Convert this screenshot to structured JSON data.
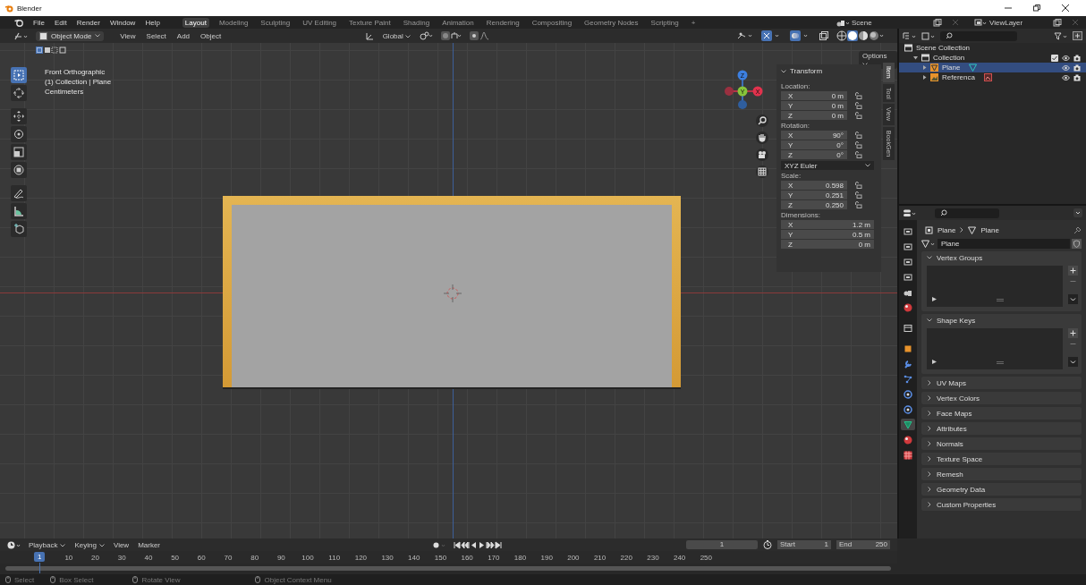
{
  "window": {
    "title": "Blender"
  },
  "menu": [
    "File",
    "Edit",
    "Render",
    "Window",
    "Help"
  ],
  "workspaces": [
    {
      "label": "Layout",
      "selected": true
    },
    {
      "label": "Modeling",
      "selected": false
    },
    {
      "label": "Sculpting",
      "selected": false
    },
    {
      "label": "UV Editing",
      "selected": false
    },
    {
      "label": "Texture Paint",
      "selected": false
    },
    {
      "label": "Shading",
      "selected": false
    },
    {
      "label": "Animation",
      "selected": false
    },
    {
      "label": "Rendering",
      "selected": false
    },
    {
      "label": "Compositing",
      "selected": false
    },
    {
      "label": "Geometry Nodes",
      "selected": false
    },
    {
      "label": "Scripting",
      "selected": false
    }
  ],
  "add_workspace": "+",
  "scene": "Scene",
  "view_layer": "ViewLayer",
  "viewport_header": {
    "mode": "Object Mode",
    "menus": [
      "View",
      "Select",
      "Add",
      "Object"
    ],
    "orientation": "Global",
    "options": "Options"
  },
  "overlay_text": [
    "Front Orthographic",
    "(1) Collection | Plane",
    "Centimeters"
  ],
  "tools": [
    {
      "kind": "select",
      "selected": true
    },
    {
      "kind": "cursor",
      "selected": false
    },
    {
      "kind": "move",
      "selected": false
    },
    {
      "kind": "rotate",
      "selected": false
    },
    {
      "kind": "scale",
      "selected": false
    },
    {
      "kind": "transform",
      "selected": false
    },
    {
      "kind": "annotate",
      "selected": false
    },
    {
      "kind": "measure",
      "selected": false
    },
    {
      "kind": "add-cube",
      "selected": false
    }
  ],
  "gizmo": [
    "Z",
    "Y",
    "X"
  ],
  "transform": {
    "title": "Transform",
    "rotation_mode": "XYZ Euler",
    "groups": [
      {
        "label": "Location:",
        "lock": true,
        "rows": [
          {
            "axis": "X",
            "value": "0 m"
          },
          {
            "axis": "Y",
            "value": "0 m"
          },
          {
            "axis": "Z",
            "value": "0 m"
          }
        ]
      },
      {
        "label": "Rotation:",
        "lock": true,
        "rows": [
          {
            "axis": "X",
            "value": "90°"
          },
          {
            "axis": "Y",
            "value": "0°"
          },
          {
            "axis": "Z",
            "value": "0°"
          }
        ]
      },
      {
        "label": "Scale:",
        "lock": true,
        "rows": [
          {
            "axis": "X",
            "value": "0.598"
          },
          {
            "axis": "Y",
            "value": "0.251"
          },
          {
            "axis": "Z",
            "value": "0.250"
          }
        ]
      },
      {
        "label": "Dimensions:",
        "lock": false,
        "rows": [
          {
            "axis": "X",
            "value": "1.2 m"
          },
          {
            "axis": "Y",
            "value": "0.5 m"
          },
          {
            "axis": "Z",
            "value": "0 m"
          }
        ]
      }
    ]
  },
  "sidebar_tabs": [
    {
      "label": "Item",
      "selected": true
    },
    {
      "label": "Tool",
      "selected": false
    },
    {
      "label": "View",
      "selected": false
    },
    {
      "label": "BookGen",
      "selected": false
    }
  ],
  "outliner": {
    "items": [
      {
        "label": "Scene Collection",
        "kind": "scene",
        "selected": false,
        "children": [
          {
            "label": "Collection",
            "kind": "collection",
            "selected": false,
            "children": [
              {
                "label": "Plane",
                "kind": "mesh",
                "selected": true
              },
              {
                "label": "Referenca",
                "kind": "image",
                "selected": false
              }
            ]
          }
        ]
      }
    ]
  },
  "properties": {
    "breadcrumb": [
      "Plane",
      "Plane"
    ],
    "data_name": "Plane",
    "tabs": [
      {
        "kind": "tool",
        "selected": false
      },
      {
        "kind": "render",
        "selected": false
      },
      {
        "kind": "output",
        "selected": false
      },
      {
        "kind": "view-layer",
        "selected": false
      },
      {
        "kind": "scene",
        "selected": false
      },
      {
        "kind": "world",
        "selected": false
      },
      {
        "kind": "collection",
        "selected": false
      },
      {
        "kind": "object",
        "selected": false
      },
      {
        "kind": "modifiers",
        "selected": false
      },
      {
        "kind": "particles",
        "selected": false
      },
      {
        "kind": "physics",
        "selected": false
      },
      {
        "kind": "constraints",
        "selected": false
      },
      {
        "kind": "data",
        "selected": true
      },
      {
        "kind": "material",
        "selected": false
      },
      {
        "kind": "texture",
        "selected": false
      }
    ],
    "panels": [
      {
        "label": "Vertex Groups",
        "expanded": true
      },
      {
        "label": "Shape Keys",
        "expanded": true
      },
      {
        "label": "UV Maps",
        "expanded": false
      },
      {
        "label": "Vertex Colors",
        "expanded": false
      },
      {
        "label": "Face Maps",
        "expanded": false
      },
      {
        "label": "Attributes",
        "expanded": false
      },
      {
        "label": "Normals",
        "expanded": false
      },
      {
        "label": "Texture Space",
        "expanded": false
      },
      {
        "label": "Remesh",
        "expanded": false
      },
      {
        "label": "Geometry Data",
        "expanded": false
      },
      {
        "label": "Custom Properties",
        "expanded": false
      }
    ]
  },
  "timeline": {
    "menus": [
      "Playback",
      "Keying",
      "View",
      "Marker"
    ],
    "current_frame": "1",
    "start_label": "Start",
    "start": "1",
    "end_label": "End",
    "end": "250",
    "cursor_frame": "1",
    "ticks": [
      "10",
      "20",
      "30",
      "40",
      "50",
      "60",
      "70",
      "80",
      "90",
      "100",
      "110",
      "120",
      "130",
      "140",
      "150",
      "160",
      "170",
      "180",
      "190",
      "200",
      "210",
      "220",
      "230",
      "240",
      "250"
    ]
  },
  "status_bar": [
    "Select",
    "Box Select",
    "Rotate View",
    "Object Context Menu"
  ]
}
